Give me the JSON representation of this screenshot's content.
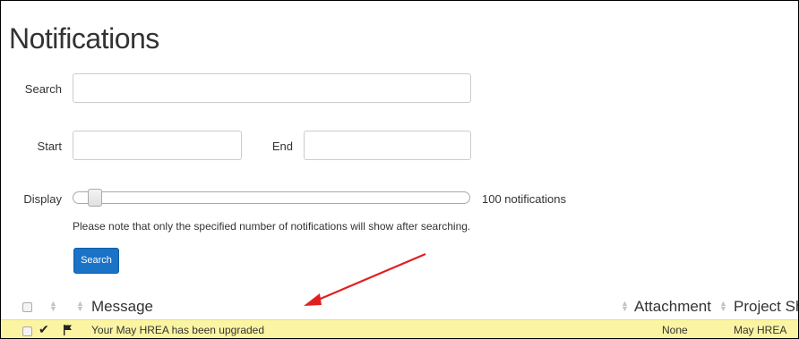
{
  "page": {
    "title": "Notifications"
  },
  "form": {
    "search_label": "Search",
    "search_value": "",
    "start_label": "Start",
    "start_value": "",
    "end_label": "End",
    "end_value": "",
    "display_label": "Display",
    "display_value": "100 notifications",
    "display_slider_fraction": 0.03,
    "help_text": "Please note that only the specified number of notifications will show after searching.",
    "search_button": "Search"
  },
  "table": {
    "columns": [
      "Message",
      "Attachment",
      "Project Sh"
    ],
    "rows": [
      {
        "checked": false,
        "read": true,
        "flagged": true,
        "message": "Your May HREA has been upgraded",
        "attachment": "None",
        "project": "May HREA",
        "highlight_color": "#fbf4a2"
      }
    ]
  },
  "annotation": {
    "arrow_color": "#e02020",
    "arrow_icon": "red-arrow-icon"
  },
  "icons": {
    "checkmark": "✔",
    "sort_up": "▲",
    "sort_down": "▼"
  },
  "colors": {
    "primary_button": "#1a73c7",
    "row_highlight": "#fbf4a2"
  }
}
